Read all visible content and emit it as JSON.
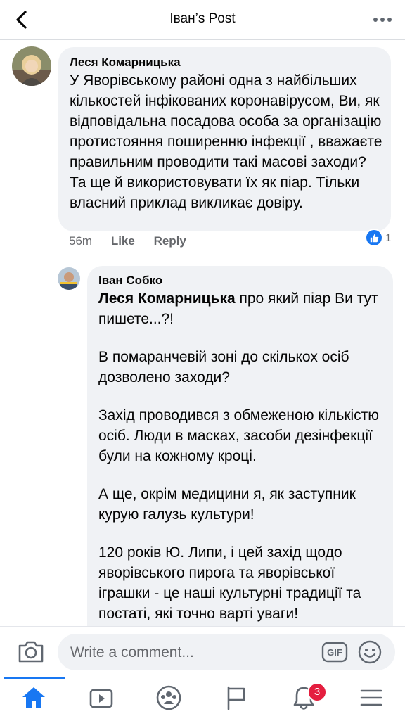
{
  "header": {
    "title": "Іван’s Post",
    "back_icon": "chevron-left-icon",
    "more_icon": "more-horizontal-icon"
  },
  "comments": [
    {
      "author": "Леся Комарницька",
      "text": "У Яворівському районі одна з найбільших кількостей інфікованих коронавірусом, Ви, як відповідальна посадова особа за організацію протистояння поширенню інфекції , вважаєте правильним проводити такі масові заходи? Та ще й використовувати їх як  піар. Тільки власний приклад викликає довіру.",
      "time": "56m",
      "like_label": "Like",
      "reply_label": "Reply",
      "reactions_count": "1"
    },
    {
      "author": "Іван Собко",
      "mention": "Леся Комарницька",
      "paragraphs": [
        " про який піар Ви тут пишете...?!",
        "В помаранчевій зоні до скількох осіб дозволено заходи?",
        "Захід проводився з обмеженою кількістю осіб. Люди в масках, засоби дезінфекції були на кожному кроці.",
        "А ще, окрім медицини я, як заступник курую галузь культури!",
        "120 років Ю. Липи, і цей захід щодо яворівського пирога та яворівської іграшки - це наші культурні традиції та постаті, які точно варті уваги!"
      ]
    }
  ],
  "composer": {
    "placeholder": "Write a comment...",
    "gif_label": "GIF"
  },
  "nav": {
    "items": [
      "home-icon",
      "video-icon",
      "groups-icon",
      "pages-flag-icon",
      "notifications-bell-icon",
      "menu-icon"
    ],
    "notifications_badge": "3",
    "active_color": "#1877f2"
  }
}
